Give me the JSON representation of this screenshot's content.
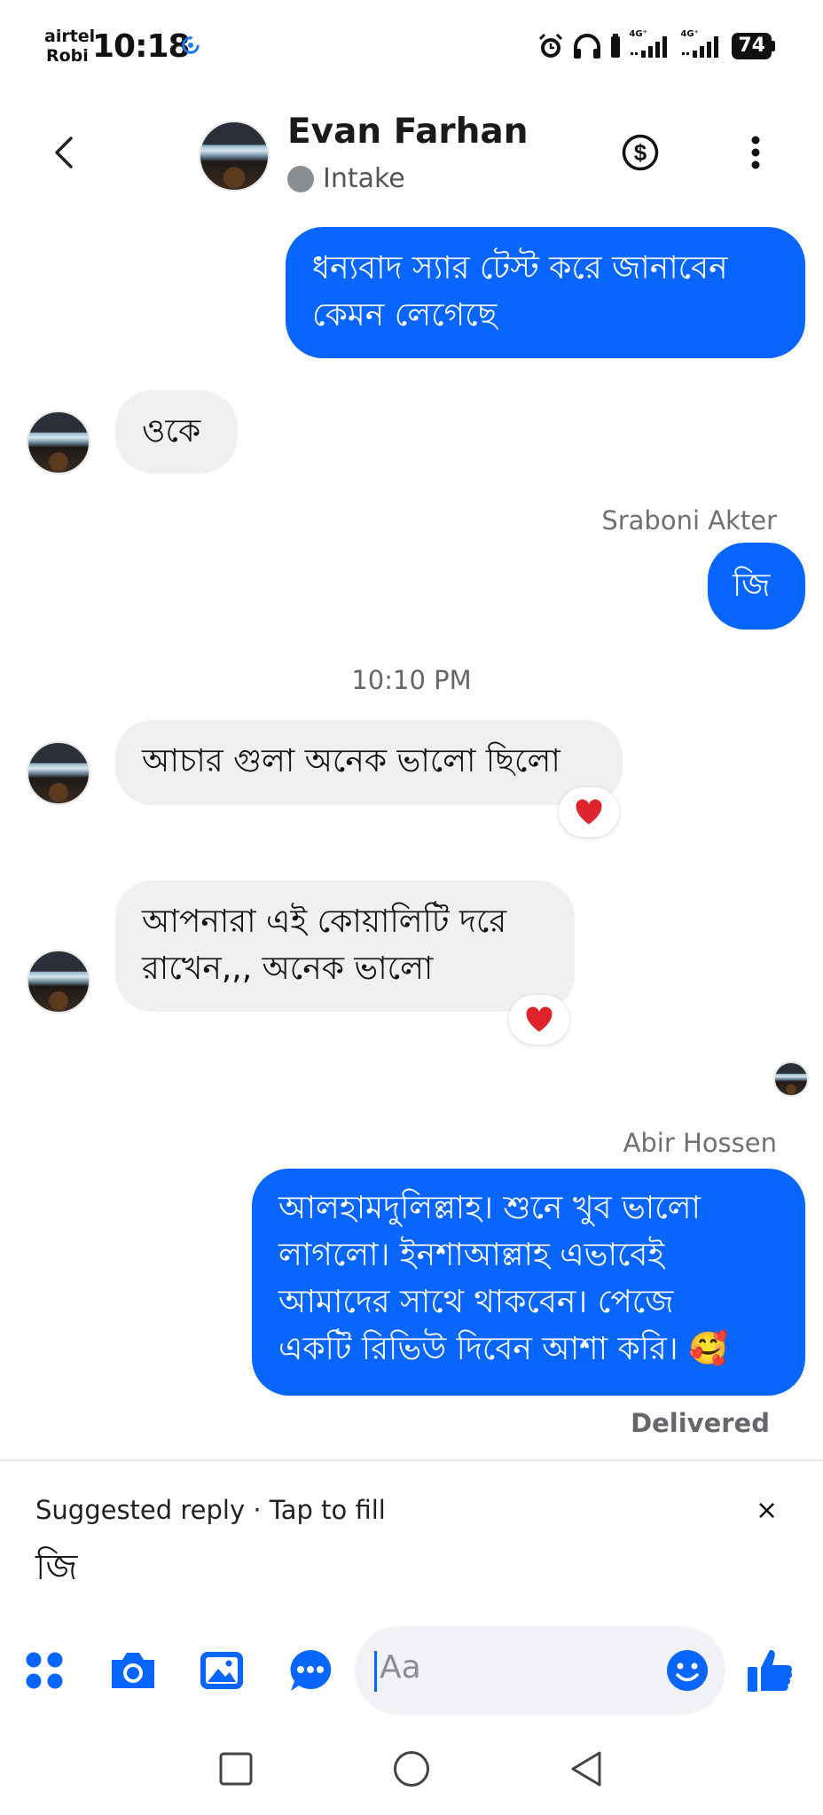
{
  "status_bar": {
    "carrier1": "airtel",
    "carrier2": "Robi",
    "time": "10:18",
    "net1": "4G⁺",
    "net2": "4G⁺",
    "battery": "74"
  },
  "header": {
    "name": "Evan Farhan",
    "status": "Intake",
    "status_color": "#8a8d91"
  },
  "messages": {
    "m1": {
      "line1": "ধন্যবাদ স্যার টেস্ট করে জানাবেন",
      "line2": "কেমন লেগেছে"
    },
    "m2": {
      "text": "ওকে"
    },
    "m3": {
      "sender": "Sraboni Akter",
      "text": "জি"
    },
    "timestamp": "10:10 PM",
    "m4": {
      "text": "আচার গুলা অনেক ভালো ছিলো",
      "reaction": "❤"
    },
    "m5": {
      "line1": "আপনারা এই কোয়ালিটি দরে",
      "line2": "রাখেন,,, অনেক ভালো",
      "reaction": "❤"
    },
    "m6": {
      "sender": "Abir Hossen",
      "line1": "আলহামদুলিল্লাহ। শুনে খুব ভালো",
      "line2": "লাগলো। ইনশাআল্লাহ এভাবেই",
      "line3": "আমাদের সাথে থাকবেন। পেজে",
      "line4": "একটি রিভিউ দিবেন আশা করি। 🥰",
      "status": "Delivered"
    }
  },
  "suggested": {
    "label": "Suggested reply · Tap to fill",
    "close": "×",
    "text": "জি"
  },
  "composer": {
    "placeholder": "Aa"
  },
  "colors": {
    "accent": "#0866ff",
    "incoming_bubble": "#f0f0f2",
    "reaction": "#e0242d"
  }
}
